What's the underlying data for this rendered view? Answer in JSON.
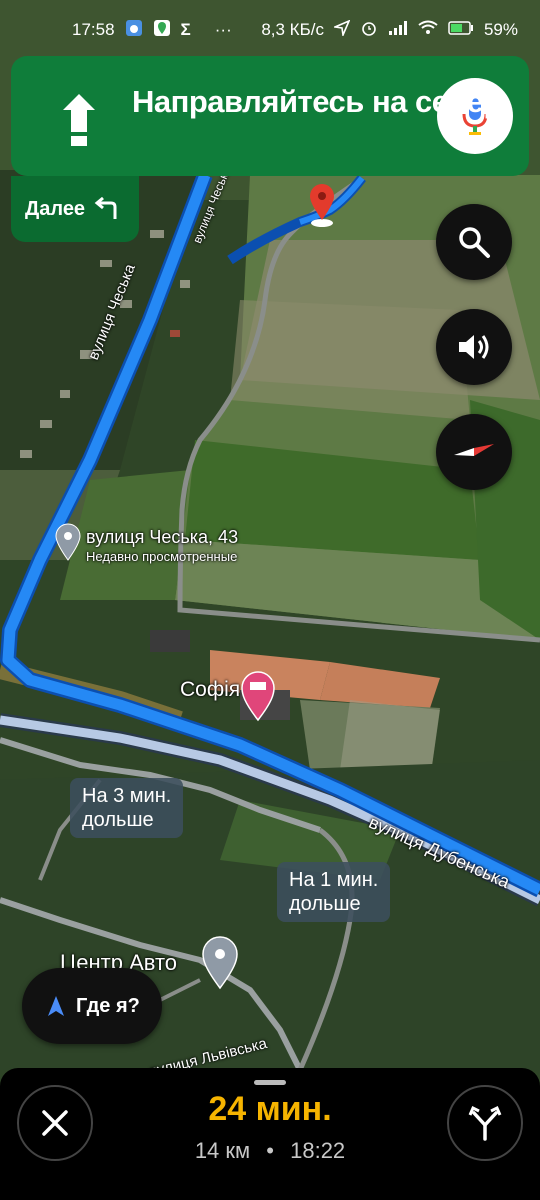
{
  "status_bar": {
    "time": "17:58",
    "network_speed": "8,3 КБ/с",
    "battery": "59%",
    "dots": "···"
  },
  "navigation": {
    "instruction": "Направляйтесь на север",
    "then_label": "Далее",
    "accent_color": "#0f7d3a"
  },
  "map": {
    "labels": {
      "street_cheska_vertical": "вулиця Чеська",
      "street_cheska_top": "вулиця Чеська",
      "place_name": "вулиця Чеська, 43",
      "place_sub": "Недавно просмотренные",
      "hotel": "Софія",
      "street_dubenska": "вулиця Дубенська",
      "auto_center": "Центр Авто",
      "street_lvivska": "вулиця Львівська"
    },
    "alt_routes": [
      {
        "line1": "На 3 мин.",
        "line2": "дольше"
      },
      {
        "line1": "На 1 мин.",
        "line2": "дольше"
      }
    ],
    "route_color": "#1a73e8"
  },
  "buttons": {
    "where_am_i": "Где я?",
    "search_icon": "search-icon",
    "sound_icon": "volume-icon",
    "compass_icon": "compass-icon"
  },
  "trip": {
    "eta": "24 мин.",
    "distance": "14 км",
    "separator": "•",
    "arrival": "18:22"
  }
}
